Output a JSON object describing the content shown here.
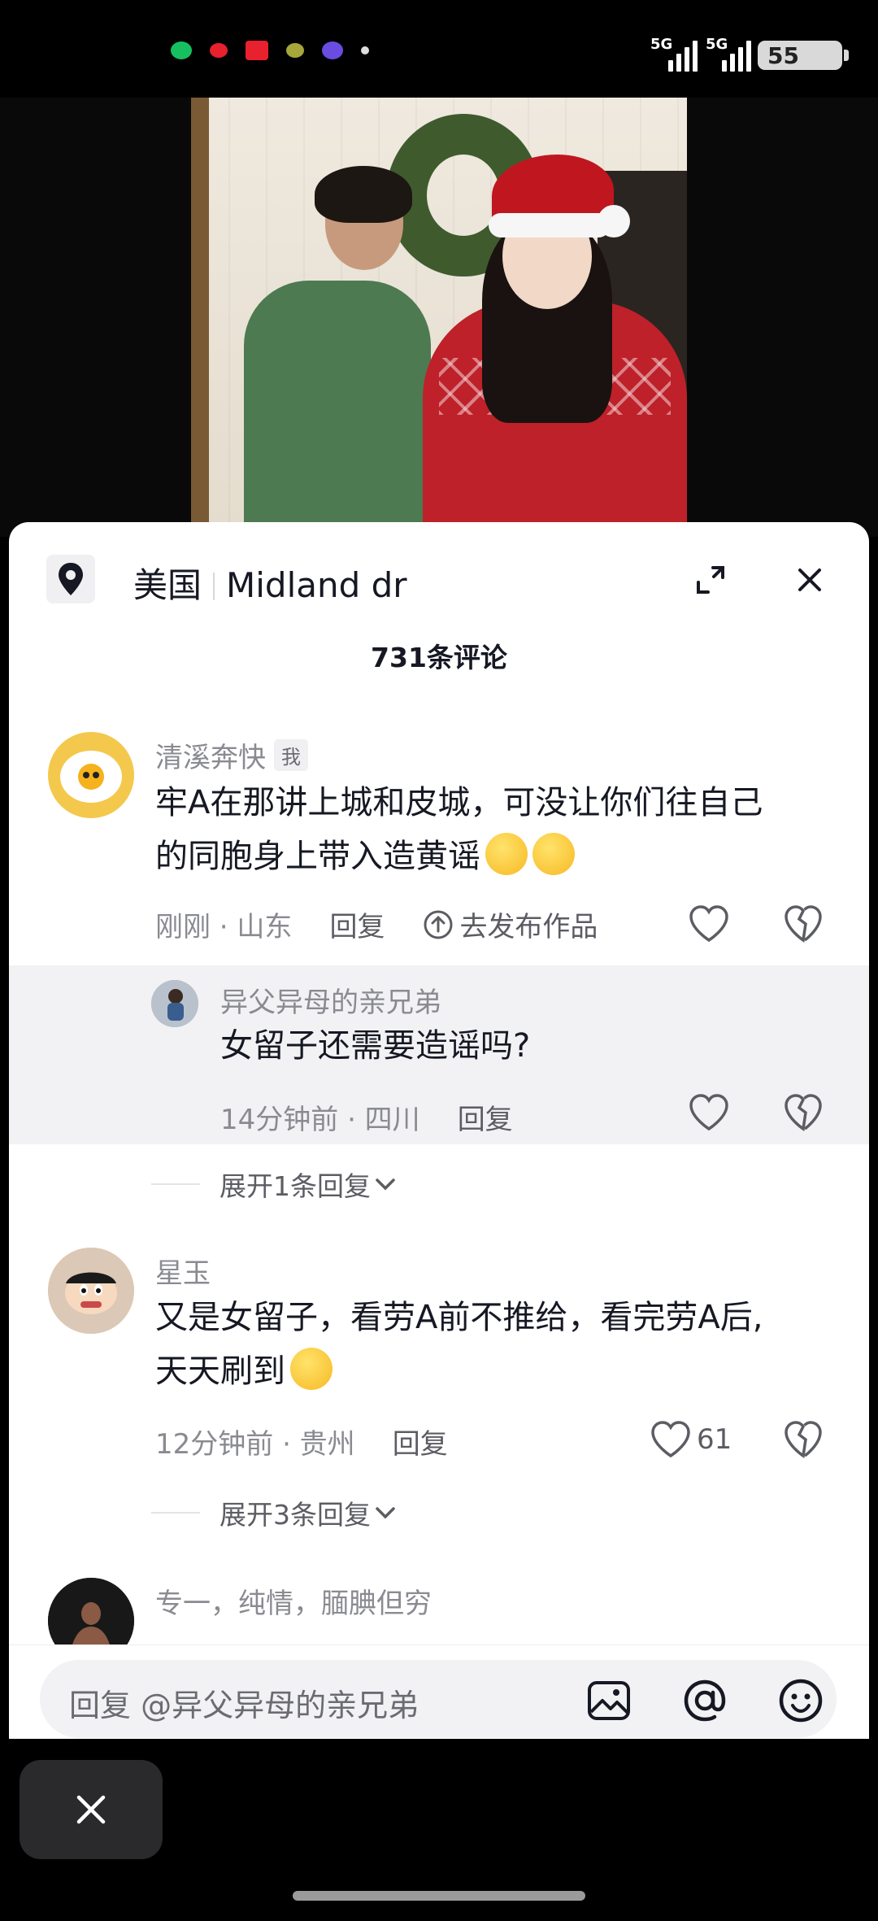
{
  "status_bar": {
    "signal_1": "5G",
    "signal_2": "5G",
    "battery": "55",
    "dot_colors": [
      "#16c060",
      "#e8212e",
      "#e8212e",
      "#a6a63a",
      "#6a4ce0"
    ]
  },
  "sheet": {
    "location": "美国",
    "place": "Midland dr",
    "comment_count_label": "731条评论"
  },
  "comments": [
    {
      "user": "清溪奔快",
      "tag": "我",
      "text_line1": "牢A在那讲上城和皮城，可没让你们往自己",
      "text_line2": "的同胞身上带入造黄谣",
      "time_location": "刚刚 · 山东",
      "reply_label": "回复",
      "publish_label": "去发布作品"
    },
    {
      "user": "异父异母的亲兄弟",
      "text": "女留子还需要造谣吗?",
      "time_location": "14分钟前 · 四川",
      "reply_label": "回复"
    },
    {
      "expand_label": "展开1条回复"
    },
    {
      "user": "星玉",
      "text_line1": "又是女留子，看劳A前不推给，看完劳A后,",
      "text_line2": "天天刷到",
      "time_location": "12分钟前 · 贵州",
      "reply_label": "回复",
      "likes": "61",
      "expand_label": "展开3条回复"
    },
    {
      "user": "专一，纯情，腼腆但穷"
    }
  ],
  "input": {
    "placeholder": "回复 @异父异母的亲兄弟"
  }
}
